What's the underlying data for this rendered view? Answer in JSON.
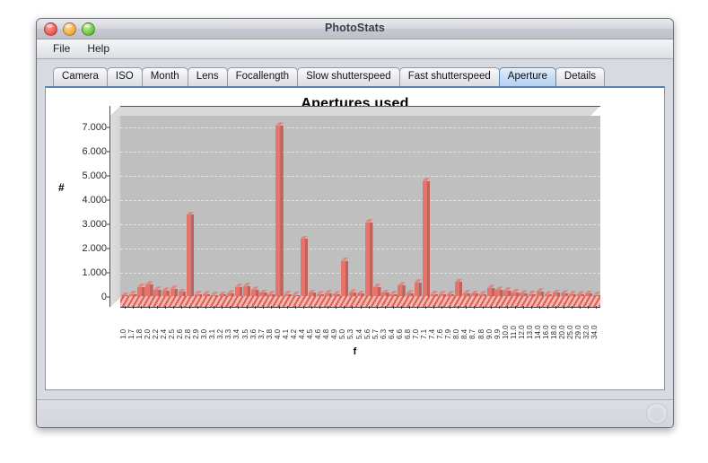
{
  "window": {
    "title": "PhotoStats",
    "controls": {
      "close": "close-button",
      "minimize": "minimize-button",
      "maximize": "maximize-button"
    }
  },
  "menubar": {
    "items": [
      {
        "label": "File"
      },
      {
        "label": "Help"
      }
    ]
  },
  "tabs": [
    {
      "label": "Camera",
      "selected": false
    },
    {
      "label": "ISO",
      "selected": false
    },
    {
      "label": "Month",
      "selected": false
    },
    {
      "label": "Lens",
      "selected": false
    },
    {
      "label": "Focallength",
      "selected": false
    },
    {
      "label": "Slow shutterspeed",
      "selected": false
    },
    {
      "label": "Fast shutterspeed",
      "selected": false
    },
    {
      "label": "Aperture",
      "selected": true
    },
    {
      "label": "Details",
      "selected": false
    }
  ],
  "statusbar": {
    "text": "",
    "grip_icon": "resize-grip-icon"
  },
  "colors": {
    "bar_front": "#e8736b",
    "bar_side": "#c0625b",
    "bar_top": "#de8780",
    "plot_floor": "#bfbfbf",
    "plot_wall": "#d9d9d9",
    "grid": "#e3e3e3",
    "tab_selected": "#b6d2f0",
    "window_chrome": "#d8dae1"
  },
  "chart_data": {
    "type": "bar",
    "title": "Apertures used",
    "xlabel": "f",
    "ylabel": "#",
    "ylim": [
      0,
      7500
    ],
    "grid": true,
    "legend_position": "none",
    "ytick_labels": [
      "0",
      "1.000",
      "2.000",
      "3.000",
      "4.000",
      "5.000",
      "6.000",
      "7.000"
    ],
    "ytick_values": [
      0,
      1000,
      2000,
      3000,
      4000,
      5000,
      6000,
      7000
    ],
    "categories": [
      "1.0",
      "1.7",
      "1.8",
      "2.0",
      "2.2",
      "2.4",
      "2.5",
      "2.6",
      "2.8",
      "2.9",
      "3.0",
      "3.1",
      "3.2",
      "3.3",
      "3.4",
      "3.5",
      "3.6",
      "3.7",
      "3.8",
      "4.0",
      "4.1",
      "4.2",
      "4.4",
      "4.5",
      "4.6",
      "4.8",
      "4.9",
      "5.0",
      "5.3",
      "5.4",
      "5.6",
      "5.7",
      "6.3",
      "6.4",
      "6.6",
      "6.8",
      "7.0",
      "7.1",
      "7.4",
      "7.6",
      "7.9",
      "8.0",
      "8.4",
      "8.7",
      "8.8",
      "9.0",
      "9.9",
      "10.0",
      "11.0",
      "12.0",
      "13.0",
      "14.0",
      "16.0",
      "18.0",
      "20.0",
      "25.0",
      "29.0",
      "32.0",
      "34.0"
    ],
    "values": [
      60,
      130,
      420,
      520,
      300,
      260,
      340,
      210,
      3400,
      130,
      110,
      90,
      100,
      150,
      420,
      460,
      300,
      170,
      120,
      7100,
      130,
      90,
      2400,
      180,
      120,
      160,
      110,
      1500,
      190,
      140,
      3100,
      420,
      170,
      130,
      480,
      150,
      600,
      4800,
      130,
      120,
      110,
      620,
      160,
      140,
      120,
      380,
      300,
      270,
      200,
      150,
      130,
      230,
      110,
      170,
      150,
      120,
      110,
      140,
      90
    ]
  }
}
